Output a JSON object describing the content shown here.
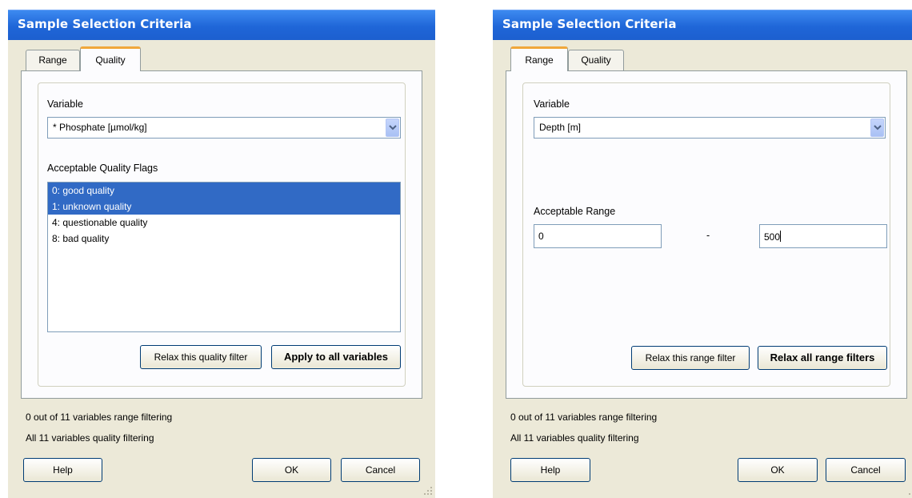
{
  "left_dialog": {
    "title": "Sample Selection Criteria",
    "tabs": [
      {
        "label": "Range"
      },
      {
        "label": "Quality"
      }
    ],
    "active_tab": "Quality",
    "variable_label": "Variable",
    "variable_value": "* Phosphate [µmol/kg]",
    "flags_label": "Acceptable Quality Flags",
    "flags": [
      {
        "label": "0: good quality",
        "selected": true
      },
      {
        "label": "1: unknown quality",
        "selected": true
      },
      {
        "label": "4: questionable quality",
        "selected": false
      },
      {
        "label": "8: bad quality",
        "selected": false
      }
    ],
    "relax_button": "Relax this quality filter",
    "apply_button": "Apply to all variables",
    "status_range": "0 out of 11 variables range filtering",
    "status_quality": "All 11 variables quality filtering",
    "help_button": "Help",
    "ok_button": "OK",
    "cancel_button": "Cancel"
  },
  "right_dialog": {
    "title": "Sample Selection Criteria",
    "tabs": [
      {
        "label": "Range"
      },
      {
        "label": "Quality"
      }
    ],
    "active_tab": "Range",
    "variable_label": "Variable",
    "variable_value": "Depth [m]",
    "range_label": "Acceptable Range",
    "range_min": "0",
    "range_separator": "-",
    "range_max": "500",
    "relax_button": "Relax this range filter",
    "relax_all_button": "Relax all range filters",
    "status_range": "0 out of 11 variables range filtering",
    "status_quality": "All 11 variables quality filtering",
    "help_button": "Help",
    "ok_button": "OK",
    "cancel_button": "Cancel"
  },
  "colors": {
    "title_bar": "#1f66d8",
    "dialog_background": "#ece9d8",
    "selection": "#316ac5",
    "active_tab_accent": "#f0a73b"
  }
}
